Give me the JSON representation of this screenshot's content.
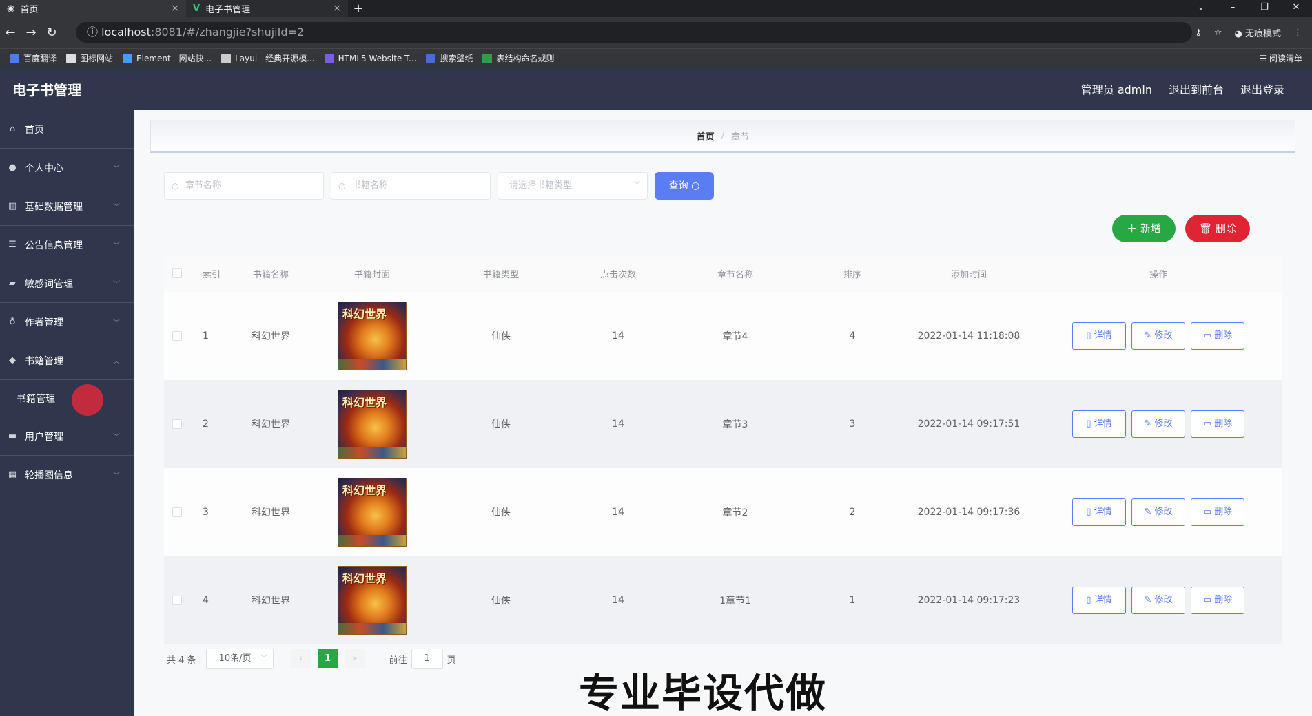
{
  "browser": {
    "tabs": [
      {
        "title": "首页",
        "close": "×"
      },
      {
        "title": "电子书管理",
        "close": "×"
      }
    ],
    "new_tab": "+",
    "url_host": "localhost",
    "url_rest": ":8081/#/zhangjie?shujiId=2",
    "profile": "无痕模式",
    "bookmarks": [
      "百度翻译",
      "图标网站",
      "Element - 网站快...",
      "Layui - 经典开源模...",
      "HTML5 Website T...",
      "搜索壁纸",
      "表结构命名规则"
    ],
    "reading_list": "阅读清单"
  },
  "header": {
    "title": "电子书管理",
    "user": "管理员 admin",
    "to_front": "退出到前台",
    "logout": "退出登录"
  },
  "sidebar": {
    "items": [
      {
        "label": "首页",
        "icon": "home-icon"
      },
      {
        "label": "个人中心",
        "icon": "user-icon"
      },
      {
        "label": "基础数据管理",
        "icon": "chart-icon"
      },
      {
        "label": "公告信息管理",
        "icon": "list-icon"
      },
      {
        "label": "敏感词管理",
        "icon": "id-card-icon"
      },
      {
        "label": "作者管理",
        "icon": "mic-icon"
      },
      {
        "label": "书籍管理",
        "icon": "tag-icon"
      },
      {
        "label": "用户管理",
        "icon": "users-icon"
      },
      {
        "label": "轮播图信息",
        "icon": "grid-icon"
      }
    ],
    "submenu_label": "书籍管理"
  },
  "breadcrumb": {
    "home": "首页",
    "sep": "/",
    "current": "章节"
  },
  "filters": {
    "chapter_placeholder": "章节名称",
    "book_placeholder": "书籍名称",
    "type_placeholder": "请选择书籍类型",
    "query_label": "查询"
  },
  "actions": {
    "add_label": "新增",
    "delete_label": "删除"
  },
  "table": {
    "headers": [
      "索引",
      "书籍名称",
      "书籍封面",
      "书籍类型",
      "点击次数",
      "章节名称",
      "排序",
      "添加时间",
      "操作"
    ],
    "cover_title": "科幻世界",
    "op_labels": {
      "detail": "详情",
      "edit": "修改",
      "delete": "删除"
    },
    "rows": [
      {
        "index": "1",
        "book": "科幻世界",
        "type": "仙侠",
        "clicks": "14",
        "chapter": "章节4",
        "sort": "4",
        "time": "2022-01-14 11:18:08"
      },
      {
        "index": "2",
        "book": "科幻世界",
        "type": "仙侠",
        "clicks": "14",
        "chapter": "章节3",
        "sort": "3",
        "time": "2022-01-14 09:17:51"
      },
      {
        "index": "3",
        "book": "科幻世界",
        "type": "仙侠",
        "clicks": "14",
        "chapter": "章节2",
        "sort": "2",
        "time": "2022-01-14 09:17:36"
      },
      {
        "index": "4",
        "book": "科幻世界",
        "type": "仙侠",
        "clicks": "14",
        "chapter": "1章节1",
        "sort": "1",
        "time": "2022-01-14 09:17:23"
      }
    ]
  },
  "pagination": {
    "total": "共 4 条",
    "page_size": "10条/页",
    "prev": "‹",
    "current": "1",
    "next": "›",
    "goto_prefix": "前往",
    "goto_value": "1",
    "goto_suffix": "页"
  },
  "watermark": "专业毕设代做",
  "colors": {
    "primary": "#5b7df3",
    "success": "#27a844",
    "danger": "#e02434",
    "sidebar": "#30364b"
  }
}
